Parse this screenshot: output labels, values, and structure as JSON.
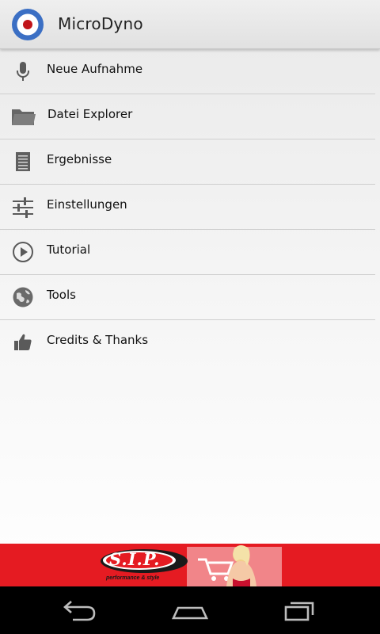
{
  "app": {
    "title": "MicroDyno",
    "colors": {
      "logo_ring": "#3b6fc4",
      "logo_center": "#c1141a",
      "accent": "#e51b22"
    }
  },
  "menu": {
    "items": [
      {
        "label": "Neue Aufnahme",
        "icon": "microphone-icon"
      },
      {
        "label": "Datei Explorer",
        "icon": "folder-icon"
      },
      {
        "label": "Ergebnisse",
        "icon": "document-icon"
      },
      {
        "label": "Einstellungen",
        "icon": "sliders-icon"
      },
      {
        "label": "Tutorial",
        "icon": "play-circle-icon"
      },
      {
        "label": "Tools",
        "icon": "globe-icon"
      },
      {
        "label": "Credits & Thanks",
        "icon": "thumbs-up-icon"
      }
    ]
  },
  "ad": {
    "brand": "S.I.P.",
    "tagline": "performance & style"
  },
  "navbar": {
    "buttons": [
      "back-icon",
      "home-icon",
      "recent-apps-icon"
    ]
  }
}
